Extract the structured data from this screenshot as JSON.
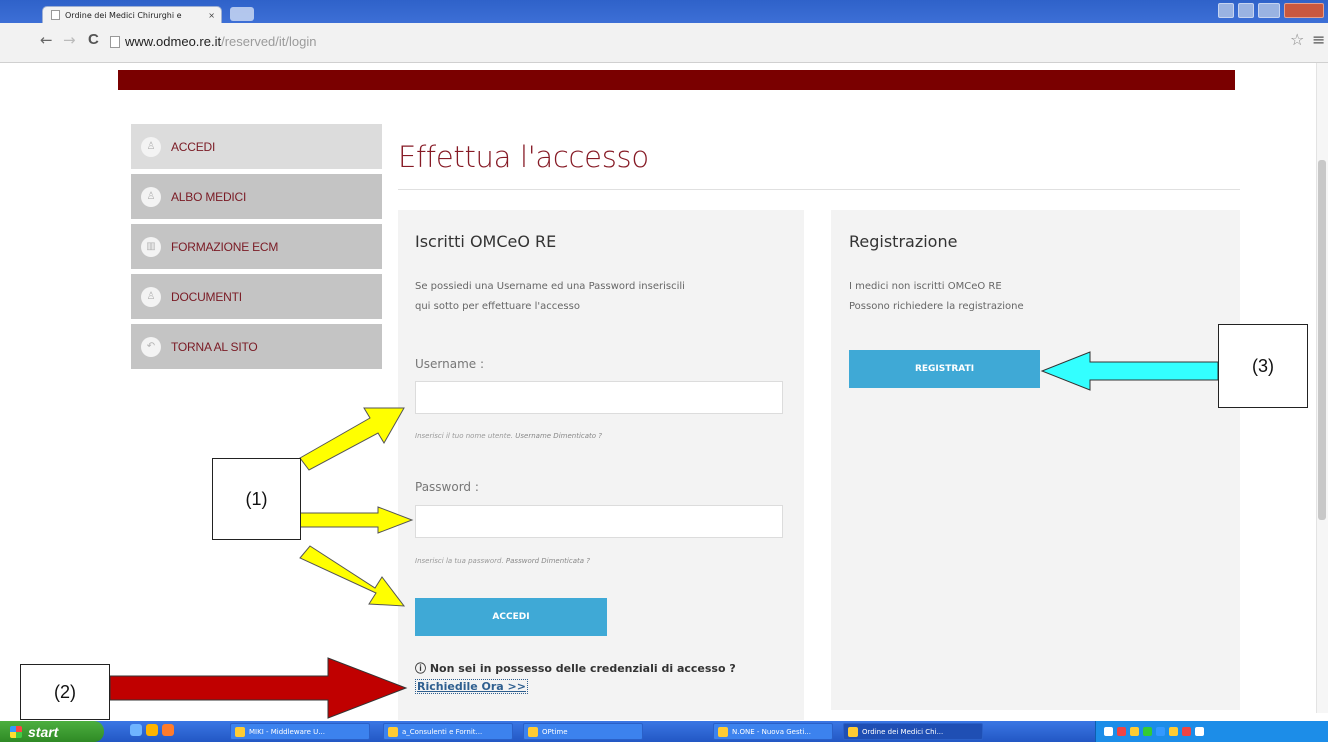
{
  "browser": {
    "tab_title": "Ordine dei Medici Chirurghi e",
    "tab_close": "×",
    "url_host": "www.odmeo.re.it",
    "url_path": "/reserved/it/login",
    "back_glyph": "←",
    "forward_glyph": "→",
    "reload_glyph": "C",
    "star_glyph": "☆",
    "menu_glyph": "≡"
  },
  "sidebar": {
    "items": [
      {
        "label": "ACCEDI",
        "icon": "user-icon",
        "glyph": "♙"
      },
      {
        "label": "ALBO MEDICI",
        "icon": "user-icon",
        "glyph": "♙"
      },
      {
        "label": "FORMAZIONE ECM",
        "icon": "building-icon",
        "glyph": "▥"
      },
      {
        "label": "DOCUMENTI",
        "icon": "user-icon",
        "glyph": "♙"
      },
      {
        "label": "TORNA AL SITO",
        "icon": "return-icon",
        "glyph": "↶"
      }
    ]
  },
  "main": {
    "title": "Effettua l'accesso",
    "login": {
      "heading": "Iscritti OMCeO RE",
      "intro_line1": "Se possiedi una Username ed una Password inseriscili",
      "intro_line2": "qui sotto per effettuare l'accesso",
      "username_label": "Username :",
      "username_value": "",
      "username_hint": "Inserisci il tuo nome utente.",
      "username_forgot": "Username Dimenticato ?",
      "password_label": "Password :",
      "password_value": "",
      "password_hint": "Inserisci la tua password.",
      "password_forgot": "Password Dimenticata ?",
      "submit_label": "ACCEDI",
      "no_credentials_icon": "info-icon",
      "no_credentials_glyph": "ⓘ",
      "no_credentials": "Non sei in possesso delle credenziali di accesso ?",
      "request_link": "Richiedile Ora >>"
    },
    "registration": {
      "heading": "Registrazione",
      "line1": "I medici non iscritti OMCeO RE",
      "line2": "Possono richiedere la registrazione",
      "button_label": "REGISTRATI"
    }
  },
  "annotations": {
    "label_1": "(1)",
    "label_2": "(2)",
    "label_3": "(3)",
    "colors": {
      "yellow": "#ffff00",
      "red": "#c00000",
      "cyan": "#33ffff"
    }
  },
  "taskbar": {
    "start_label": "start",
    "items": [
      "MIKI - Middleware U...",
      "a_Consulenti e Fornit...",
      "OPtime",
      "N.ONE - Nuova Gesti...",
      "Ordine dei Medici Chi..."
    ]
  }
}
